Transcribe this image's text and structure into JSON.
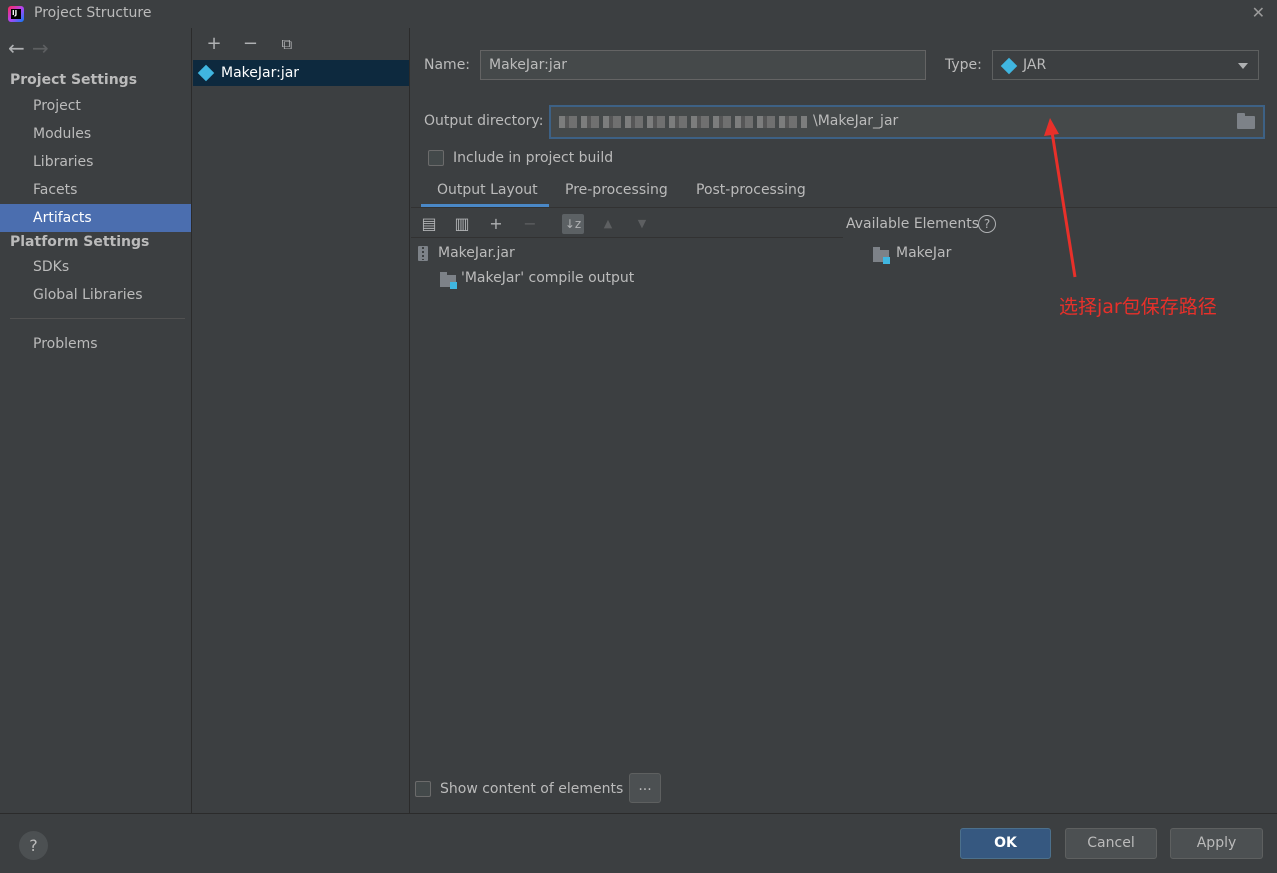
{
  "window": {
    "title": "Project Structure"
  },
  "nav": {
    "back_icon": "arrow-left-icon",
    "forward_icon": "arrow-right-icon",
    "section_project": "Project Settings",
    "items_project": [
      "Project",
      "Modules",
      "Libraries",
      "Facets",
      "Artifacts"
    ],
    "selected": "Artifacts",
    "section_platform": "Platform Settings",
    "items_platform": [
      "SDKs",
      "Global Libraries"
    ],
    "problems": "Problems"
  },
  "artifacts": {
    "toolbar": {
      "add": "+",
      "remove": "−",
      "copy_icon": "copy-icon"
    },
    "items": [
      "MakeJar:jar"
    ]
  },
  "artifact": {
    "name_label": "Name:",
    "name_value": "MakeJar:jar",
    "type_label": "Type:",
    "type_value": "JAR",
    "output_label": "Output directory:",
    "output_value": "\\MakeJar_jar",
    "include_in_build_label": "Include in project build",
    "include_in_build_checked": false
  },
  "tabs": [
    "Output Layout",
    "Pre-processing",
    "Post-processing"
  ],
  "active_tab": "Output Layout",
  "layout_tree": {
    "root": "MakeJar.jar",
    "children": [
      "'MakeJar' compile output"
    ]
  },
  "available": {
    "header": "Available Elements",
    "help": "?",
    "items": [
      "MakeJar"
    ]
  },
  "show_content_label": "Show content of elements",
  "show_content_checked": false,
  "dots_button": "...",
  "annotation": {
    "text": "选择jar包保存路径",
    "color": "#e8302a"
  },
  "footer": {
    "help": "?",
    "ok": "OK",
    "cancel": "Cancel",
    "apply": "Apply"
  }
}
